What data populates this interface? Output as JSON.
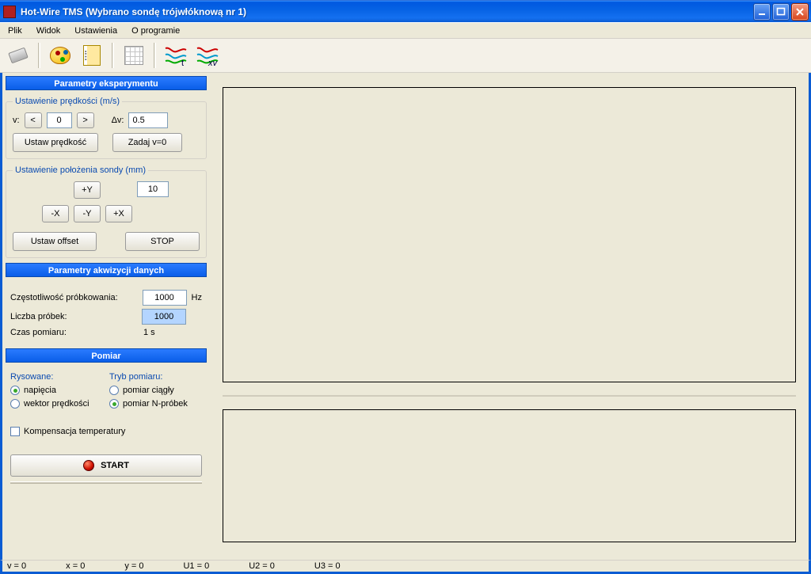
{
  "title": "Hot-Wire TMS   (Wybrano sondę trójwłóknową nr 1)",
  "menu": {
    "plik": "Plik",
    "widok": "Widok",
    "ustawienia": "Ustawienia",
    "oprog": "O programie"
  },
  "sections": {
    "eksperyment": "Parametry eksperymentu",
    "akwizycja": "Parametry akwizycji danych",
    "pomiar": "Pomiar"
  },
  "velocity": {
    "legend": "Ustawienie prędkości (m/s)",
    "v_label": "v:",
    "dec": "<",
    "val": "0",
    "inc": ">",
    "dv_label": "Δv:",
    "dv_val": "0.5",
    "set_btn": "Ustaw prędkość",
    "zero_btn": "Zadaj v=0"
  },
  "position": {
    "legend": "Ustawienie położenia sondy (mm)",
    "py": "+Y",
    "my": "-Y",
    "px": "+X",
    "mx": "-X",
    "step": "10",
    "offset_btn": "Ustaw offset",
    "stop_btn": "STOP"
  },
  "acq": {
    "freq_label": "Częstotliwość próbkowania:",
    "freq_val": "1000",
    "freq_unit": "Hz",
    "samples_label": "Liczba próbek:",
    "samples_val": "1000",
    "time_label": "Czas pomiaru:",
    "time_val": "1 s"
  },
  "pomiar": {
    "rysowane_hdr": "Rysowane:",
    "tryb_hdr": "Tryb pomiaru:",
    "r_napiecia": "napięcia",
    "r_wektor": "wektor prędkości",
    "t_ciagly": "pomiar ciągły",
    "t_nprobek": "pomiar N-próbek",
    "komp": "Kompensacja temperatury",
    "start": "START"
  },
  "status": {
    "v": "v = 0",
    "x": "x = 0",
    "y": "y = 0",
    "u1": "U1 = 0",
    "u2": "U2 = 0",
    "u3": "U3 = 0"
  }
}
